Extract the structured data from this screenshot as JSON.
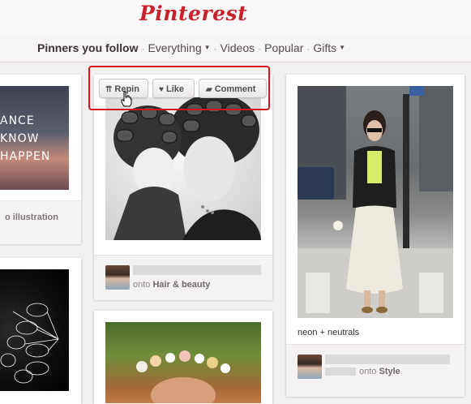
{
  "app": {
    "logo_text": "Pinterest"
  },
  "nav": {
    "items": [
      {
        "label": "Pinners you follow"
      },
      {
        "label": "Everything"
      },
      {
        "label": "Videos"
      },
      {
        "label": "Popular"
      },
      {
        "label": "Gifts"
      }
    ],
    "separator": "·"
  },
  "actions": {
    "repin": "Repin",
    "like": "Like",
    "comment": "Comment"
  },
  "pins": {
    "left_top": {
      "image_text": "ANCE\nKNOW\nHAPPEN",
      "onto": "o illustration"
    },
    "middle_top": {
      "onto_prefix": "onto",
      "board": "Hair & beauty"
    },
    "right_top": {
      "caption": "neon + neutrals",
      "onto_prefix": "onto",
      "board": "Style"
    }
  },
  "colors": {
    "brand": "#c8232c",
    "highlight": "#d8141b"
  }
}
